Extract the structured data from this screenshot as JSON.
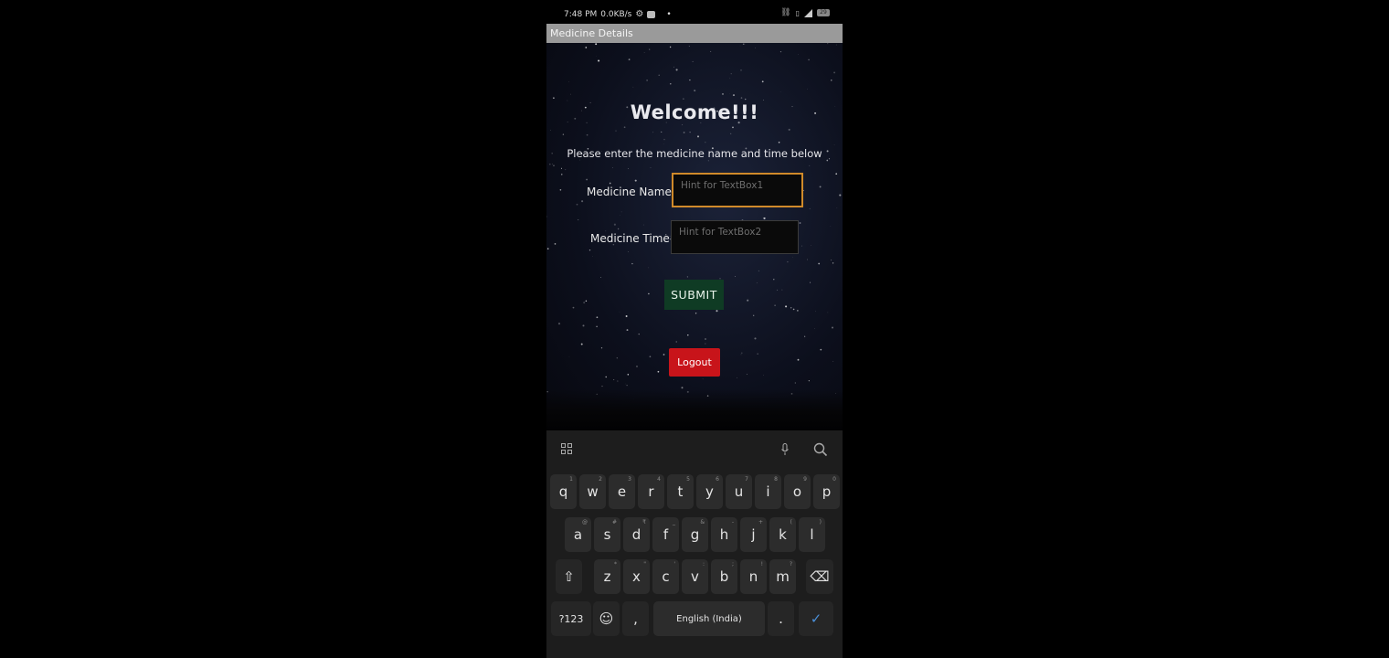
{
  "status_bar": {
    "time": "7:48 PM",
    "speed": "0.0KB/s",
    "dot": "•",
    "battery": "29"
  },
  "title_bar": {
    "title": "Medicine Details"
  },
  "form": {
    "welcome": "Welcome!!!",
    "instruction": "Please enter the medicine name and time below",
    "name_label": "Medicine Name:",
    "name_placeholder": "Hint for TextBox1",
    "time_label": "Medicine Time:",
    "time_placeholder": "Hint for TextBox2",
    "submit_label": "SUBMIT",
    "logout_label": "Logout"
  },
  "colors": {
    "submit_bg": "#0f3b24",
    "logout_bg": "#c8141a",
    "focus_border": "#d08a2a",
    "title_bar_bg": "#9a9a9a"
  },
  "keyboard": {
    "row1": [
      {
        "k": "q",
        "n": "1"
      },
      {
        "k": "w",
        "n": "2"
      },
      {
        "k": "e",
        "n": "3"
      },
      {
        "k": "r",
        "n": "4"
      },
      {
        "k": "t",
        "n": "5"
      },
      {
        "k": "y",
        "n": "6"
      },
      {
        "k": "u",
        "n": "7"
      },
      {
        "k": "i",
        "n": "8"
      },
      {
        "k": "o",
        "n": "9"
      },
      {
        "k": "p",
        "n": "0"
      }
    ],
    "row2": [
      {
        "k": "a",
        "n": "@"
      },
      {
        "k": "s",
        "n": "#"
      },
      {
        "k": "d",
        "n": "₹"
      },
      {
        "k": "f",
        "n": "_"
      },
      {
        "k": "g",
        "n": "&"
      },
      {
        "k": "h",
        "n": "-"
      },
      {
        "k": "j",
        "n": "+"
      },
      {
        "k": "k",
        "n": "("
      },
      {
        "k": "l",
        "n": ")"
      }
    ],
    "row3": [
      {
        "k": "z",
        "n": "*"
      },
      {
        "k": "x",
        "n": "\""
      },
      {
        "k": "c",
        "n": "'"
      },
      {
        "k": "v",
        "n": ":"
      },
      {
        "k": "b",
        "n": ";"
      },
      {
        "k": "n",
        "n": "!"
      },
      {
        "k": "m",
        "n": "?"
      }
    ],
    "symbols_key": "?123",
    "emoji_key": "☺",
    "comma_key": ",",
    "space_label": "English (India)",
    "period_key": ".",
    "shift_key": "⇧",
    "backspace_key": "⌫",
    "done_key": "✓"
  }
}
